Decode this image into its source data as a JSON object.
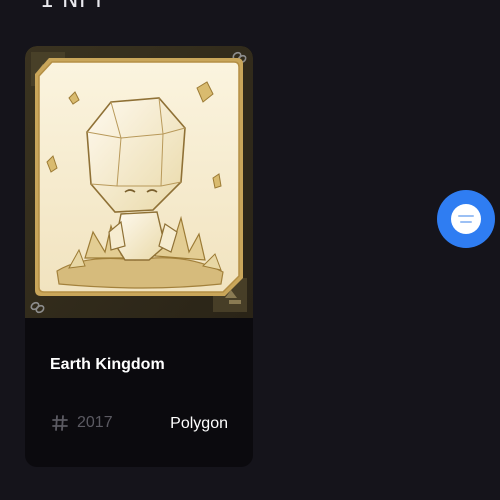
{
  "page": {
    "section_title": "1 NFT"
  },
  "nft_card": {
    "name": "Earth Kingdom",
    "token_id": "2017",
    "chain": "Polygon",
    "artwork_icon": "crystal-creature-card-art",
    "id_icon": "hash-icon"
  },
  "chat": {
    "icon": "chat-icon",
    "accent": "#2f7df2"
  },
  "colors": {
    "background": "#15141b",
    "card": "#0b0a0e",
    "gold": "#c9a65a",
    "muted_text": "#5b5a62"
  }
}
